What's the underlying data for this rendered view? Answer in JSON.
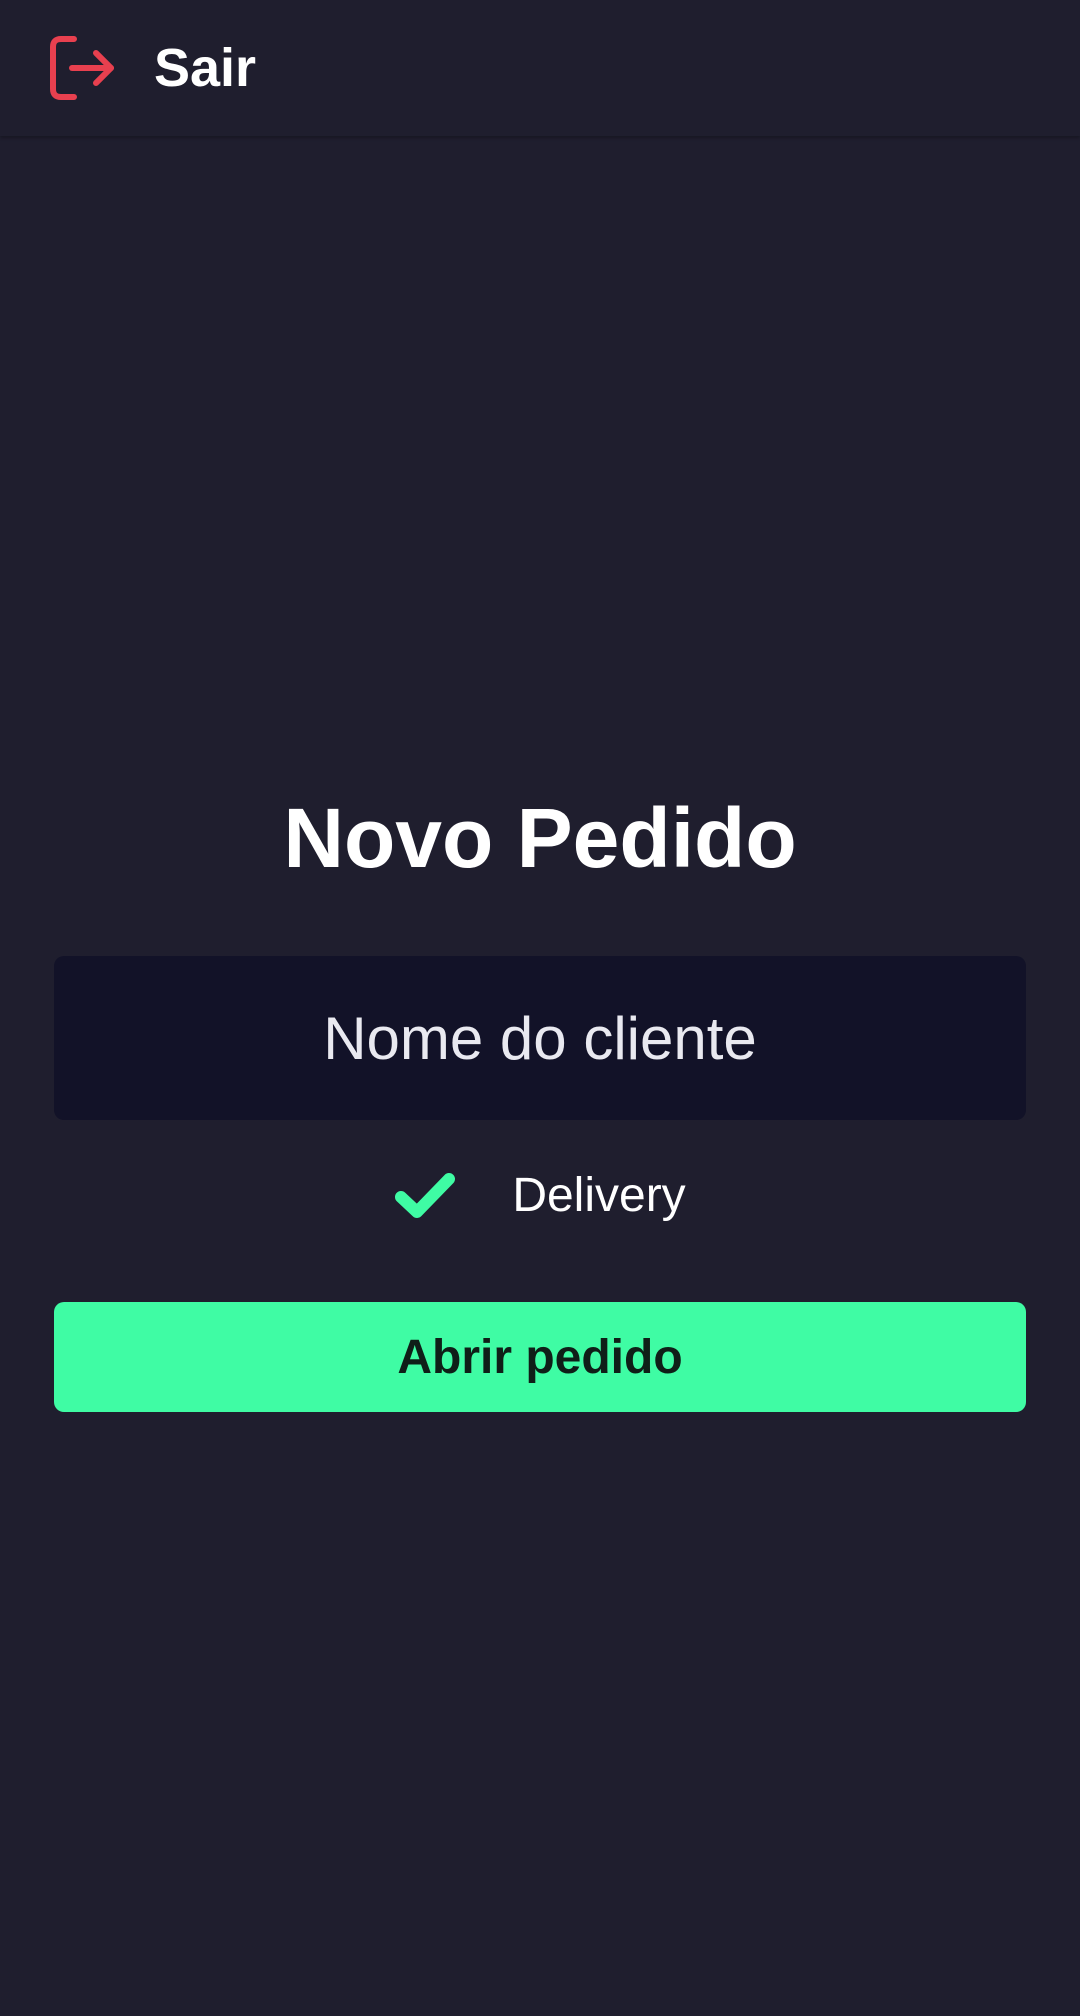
{
  "header": {
    "logout_label": "Sair",
    "logout_icon": "logout-icon"
  },
  "main": {
    "title": "Novo Pedido",
    "customer_name": {
      "placeholder": "Nome do cliente",
      "value": ""
    },
    "delivery": {
      "label": "Delivery",
      "checked": true,
      "icon": "check-icon"
    },
    "open_order_label": "Abrir pedido"
  },
  "colors": {
    "background": "#1f1e2e",
    "input_background": "#121228",
    "accent": "#3ffca4",
    "logout_icon": "#e8404f"
  }
}
